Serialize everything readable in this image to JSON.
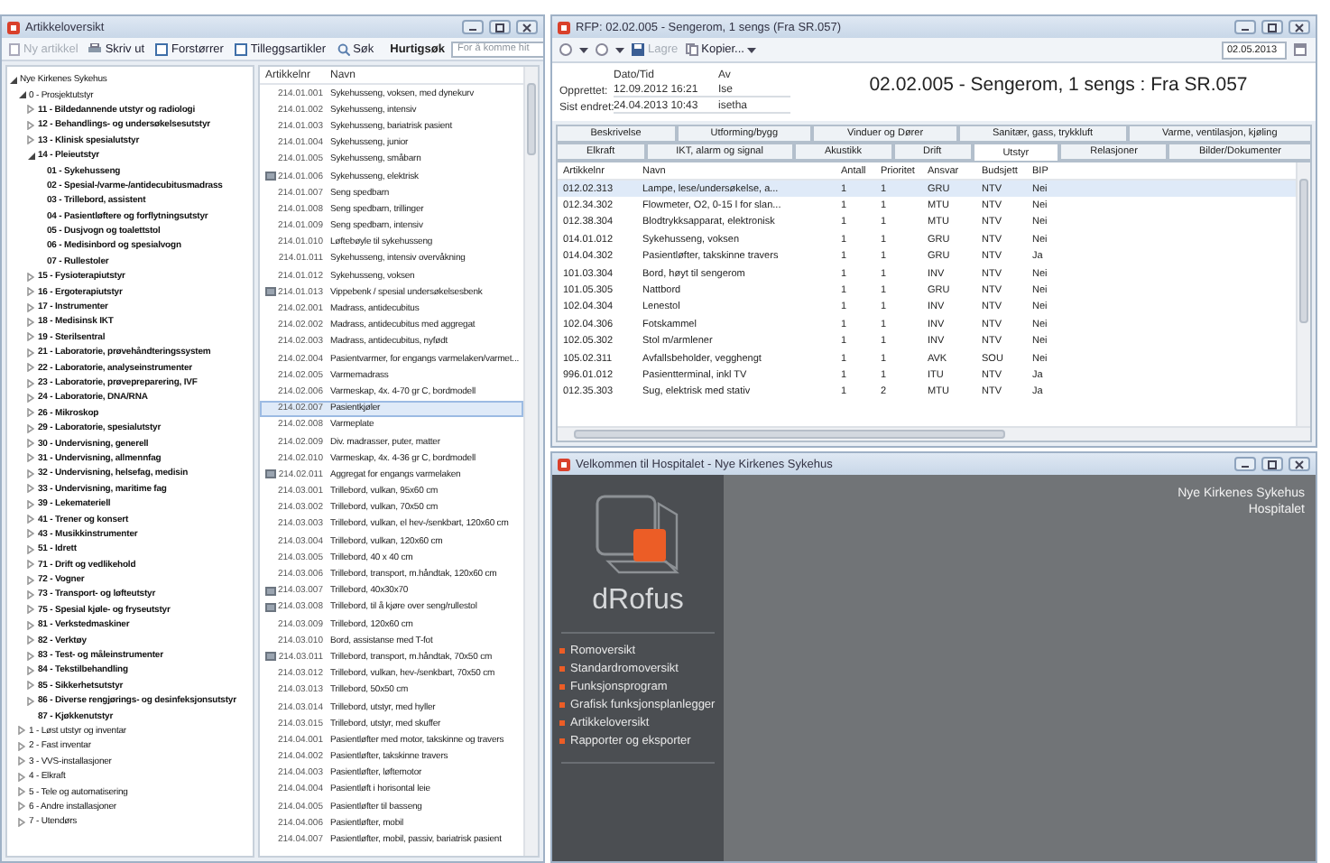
{
  "article_window": {
    "title": "Artikkeloversikt",
    "toolbar": [
      {
        "label": "Ny artikkel",
        "disabled": true
      },
      {
        "label": "Skriv ut",
        "disabled": false
      },
      {
        "label": "Forstørrer",
        "disabled": false
      },
      {
        "label": "Tilleggsartikler",
        "disabled": false
      },
      {
        "label": "Søk",
        "disabled": false
      }
    ],
    "quick_search": {
      "label": "Hurtigsøk",
      "placeholder": "For å komme hit"
    },
    "tree": [
      {
        "label": "Nye Kirkenes Sykehus",
        "expanded": true,
        "children": [
          {
            "label": "0 - Prosjektutstyr",
            "expanded": true,
            "children": [
              {
                "label": "11 - Bildedannende utstyr og radiologi",
                "expanded": false
              },
              {
                "label": "12 - Behandlings- og undersøkelsesutstyr",
                "expanded": false
              },
              {
                "label": "13 - Klinisk spesialutstyr",
                "expanded": false
              },
              {
                "label": "14 - Pleieutstyr",
                "expanded": true,
                "children": [
                  {
                    "label": "01 - Sykehusseng"
                  },
                  {
                    "label": "02 - Spesial-/varme-/antidecubitusmadrass"
                  },
                  {
                    "label": "03 - Trillebord, assistent"
                  },
                  {
                    "label": "04 - Pasientløftere og forflytningsutstyr"
                  },
                  {
                    "label": "05 - Dusjvogn og toalettstol"
                  },
                  {
                    "label": "06 - Medisinbord og spesialvogn"
                  },
                  {
                    "label": "07 - Rullestoler"
                  }
                ]
              },
              {
                "label": "15 - Fysioterapiutstyr",
                "expanded": false
              },
              {
                "label": "16 - Ergoterapiutstyr",
                "expanded": false
              },
              {
                "label": "17 - Instrumenter",
                "expanded": false
              },
              {
                "label": "18 - Medisinsk IKT",
                "expanded": false
              },
              {
                "label": "19 - Sterilsentral",
                "expanded": false
              },
              {
                "label": "21 - Laboratorie, prøvehåndteringssystem",
                "expanded": false
              },
              {
                "label": "22 - Laboratorie, analyseinstrumenter",
                "expanded": false
              },
              {
                "label": "23 - Laboratorie, prøvepreparering, IVF",
                "expanded": false
              },
              {
                "label": "24 - Laboratorie, DNA/RNA",
                "expanded": false
              },
              {
                "label": "26 - Mikroskop",
                "expanded": false
              },
              {
                "label": "29 - Laboratorie, spesialutstyr",
                "expanded": false
              },
              {
                "label": "30 - Undervisning, generell",
                "expanded": false
              },
              {
                "label": "31 - Undervisning, allmennfag",
                "expanded": false
              },
              {
                "label": "32 - Undervisning, helsefag, medisin",
                "expanded": false
              },
              {
                "label": "33 - Undervisning, maritime fag",
                "expanded": false
              },
              {
                "label": "39 - Lekemateriell",
                "expanded": false
              },
              {
                "label": "41 - Trener og konsert",
                "expanded": false
              },
              {
                "label": "43 - Musikkinstrumenter",
                "expanded": false
              },
              {
                "label": "51 - Idrett",
                "expanded": false
              },
              {
                "label": "71 - Drift og vedlikehold",
                "expanded": false
              },
              {
                "label": "72 - Vogner",
                "expanded": false
              },
              {
                "label": "73 - Transport- og løfteutstyr",
                "expanded": false
              },
              {
                "label": "75 - Spesial kjøle- og fryseutstyr",
                "expanded": false
              },
              {
                "label": "81 - Verkstedmaskiner",
                "expanded": false
              },
              {
                "label": "82 - Verktøy",
                "expanded": false
              },
              {
                "label": "83 - Test- og måleinstrumenter",
                "expanded": false
              },
              {
                "label": "84 - Tekstilbehandling",
                "expanded": false
              },
              {
                "label": "85 - Sikkerhetsutstyr",
                "expanded": false
              },
              {
                "label": "86 - Diverse rengjørings- og desinfeksjonsutstyr",
                "expanded": false
              },
              {
                "label": "87 - Kjøkkenutstyr"
              }
            ]
          },
          {
            "label": "1 - Løst utstyr og inventar",
            "expanded": false
          },
          {
            "label": "2 - Fast inventar",
            "expanded": false
          },
          {
            "label": "3 - VVS-installasjoner",
            "expanded": false
          },
          {
            "label": "4 - Elkraft",
            "expanded": false
          },
          {
            "label": "5 - Tele og automatisering",
            "expanded": false
          },
          {
            "label": "6 - Andre installasjoner",
            "expanded": false
          },
          {
            "label": "7 - Utendørs",
            "expanded": false
          }
        ]
      }
    ],
    "list": {
      "columns": [
        "Artikkelnr",
        "Navn"
      ],
      "rows": [
        {
          "code": "214.01.001",
          "name": "Sykehusseng, voksen, med dynekurv",
          "marked": false,
          "selected": false
        },
        {
          "code": "214.01.002",
          "name": "Sykehusseng, intensiv",
          "marked": false,
          "selected": false
        },
        {
          "code": "214.01.003",
          "name": "Sykehusseng, bariatrisk pasient",
          "marked": false,
          "selected": false
        },
        {
          "code": "214.01.004",
          "name": "Sykehusseng, junior",
          "marked": false,
          "selected": false
        },
        {
          "code": "214.01.005",
          "name": "Sykehusseng, småbarn",
          "marked": false,
          "selected": false
        },
        {
          "code": "214.01.006",
          "name": "Sykehusseng, elektrisk",
          "marked": true,
          "selected": false
        },
        {
          "code": "214.01.007",
          "name": "Seng spedbarn",
          "marked": false,
          "selected": false
        },
        {
          "code": "214.01.008",
          "name": "Seng spedbarn, trillinger",
          "marked": false,
          "selected": false
        },
        {
          "code": "214.01.009",
          "name": "Seng spedbarn, intensiv",
          "marked": false,
          "selected": false
        },
        {
          "code": "214.01.010",
          "name": "Løftebøyle til sykehusseng",
          "marked": false,
          "selected": false
        },
        {
          "code": "214.01.011",
          "name": "Sykehusseng, intensiv overvåkning",
          "marked": false,
          "selected": false
        },
        {
          "code": "214.01.012",
          "name": "Sykehusseng, voksen",
          "marked": false,
          "selected": false
        },
        {
          "code": "214.01.013",
          "name": "Vippebenk / spesial undersøkelsesbenk",
          "marked": true,
          "selected": false
        },
        {
          "code": "214.02.001",
          "name": "Madrass, antidecubitus",
          "marked": false,
          "selected": false
        },
        {
          "code": "214.02.002",
          "name": "Madrass, antidecubitus med aggregat",
          "marked": false,
          "selected": false
        },
        {
          "code": "214.02.003",
          "name": "Madrass, antidecubitus, nyfødt",
          "marked": false,
          "selected": false
        },
        {
          "code": "214.02.004",
          "name": "Pasientvarmer, for engangs varmelaken/varmet...",
          "marked": false,
          "selected": false
        },
        {
          "code": "214.02.005",
          "name": "Varmemadrass",
          "marked": false,
          "selected": false
        },
        {
          "code": "214.02.006",
          "name": "Varmeskap, 4x. 4-70 gr C, bordmodell",
          "marked": false,
          "selected": false
        },
        {
          "code": "214.02.007",
          "name": "Pasientkjøler",
          "marked": false,
          "selected": true
        },
        {
          "code": "214.02.008",
          "name": "Varmeplate",
          "marked": false,
          "selected": false
        },
        {
          "code": "214.02.009",
          "name": "Div. madrasser, puter, matter",
          "marked": false,
          "selected": false
        },
        {
          "code": "214.02.010",
          "name": "Varmeskap, 4x. 4-36 gr C, bordmodell",
          "marked": false,
          "selected": false
        },
        {
          "code": "214.02.011",
          "name": "Aggregat for engangs varmelaken",
          "marked": true,
          "selected": false
        },
        {
          "code": "214.03.001",
          "name": "Trillebord, vulkan, 95x60 cm",
          "marked": false,
          "selected": false
        },
        {
          "code": "214.03.002",
          "name": "Trillebord, vulkan, 70x50 cm",
          "marked": false,
          "selected": false
        },
        {
          "code": "214.03.003",
          "name": "Trillebord, vulkan, el hev-/senkbart, 120x60 cm",
          "marked": false,
          "selected": false
        },
        {
          "code": "214.03.004",
          "name": "Trillebord, vulkan, 120x60 cm",
          "marked": false,
          "selected": false
        },
        {
          "code": "214.03.005",
          "name": "Trillebord, 40 x 40 cm",
          "marked": false,
          "selected": false
        },
        {
          "code": "214.03.006",
          "name": "Trillebord, transport, m.håndtak, 120x60 cm",
          "marked": false,
          "selected": false
        },
        {
          "code": "214.03.007",
          "name": "Trillebord, 40x30x70",
          "marked": true,
          "selected": false
        },
        {
          "code": "214.03.008",
          "name": "Trillebord, til å kjøre over seng/rullestol",
          "marked": true,
          "selected": false
        },
        {
          "code": "214.03.009",
          "name": "Trillebord, 120x60 cm",
          "marked": false,
          "selected": false
        },
        {
          "code": "214.03.010",
          "name": "Bord, assistanse med T-fot",
          "marked": false,
          "selected": false
        },
        {
          "code": "214.03.011",
          "name": "Trillebord, transport, m.håndtak, 70x50 cm",
          "marked": true,
          "selected": false
        },
        {
          "code": "214.03.012",
          "name": "Trillebord, vulkan, hev-/senkbart, 70x50 cm",
          "marked": false,
          "selected": false
        },
        {
          "code": "214.03.013",
          "name": "Trillebord, 50x50 cm",
          "marked": false,
          "selected": false
        },
        {
          "code": "214.03.014",
          "name": "Trillebord, utstyr, med hyller",
          "marked": false,
          "selected": false
        },
        {
          "code": "214.03.015",
          "name": "Trillebord, utstyr, med skuffer",
          "marked": false,
          "selected": false
        },
        {
          "code": "214.04.001",
          "name": "Pasientløfter med motor, takskinne og travers",
          "marked": false,
          "selected": false
        },
        {
          "code": "214.04.002",
          "name": "Pasientløfter, takskinne travers",
          "marked": false,
          "selected": false
        },
        {
          "code": "214.04.003",
          "name": "Pasientløfter, løftemotor",
          "marked": false,
          "selected": false
        },
        {
          "code": "214.04.004",
          "name": "Pasientløft i horisontal leie",
          "marked": false,
          "selected": false
        },
        {
          "code": "214.04.005",
          "name": "Pasientløfter til basseng",
          "marked": false,
          "selected": false
        },
        {
          "code": "214.04.006",
          "name": "Pasientløfter, mobil",
          "marked": false,
          "selected": false
        },
        {
          "code": "214.04.007",
          "name": "Pasientløfter, mobil, passiv, bariatrisk pasient",
          "marked": false,
          "selected": false
        }
      ]
    }
  },
  "room_window": {
    "title": "RFP: 02.02.005 - Sengerom, 1 sengs (Fra SR.057)",
    "toolbar": {
      "save": {
        "label": "Lagre",
        "disabled": true
      },
      "copy": {
        "label": "Kopier..."
      },
      "date": "02.05.2013"
    },
    "info": {
      "headers": [
        "Dato/Tid",
        "Av"
      ],
      "rows": [
        {
          "label": "Opprettet:",
          "date": "12.09.2012 16:21",
          "by": "Ise"
        },
        {
          "label": "Sist endret:",
          "date": "24.04.2013 10:43",
          "by": "isetha"
        }
      ]
    },
    "heading": "02.02.005 - Sengerom, 1 sengs : Fra SR.057",
    "tabs": [
      [
        {
          "label": "Beskrivelse",
          "selected": false
        },
        {
          "label": "Utforming/bygg",
          "selected": false
        },
        {
          "label": "Vinduer og Dører",
          "selected": false
        },
        {
          "label": "Sanitær, gass, trykkluft",
          "selected": false
        },
        {
          "label": "Varme, ventilasjon, kjøling",
          "selected": false
        }
      ],
      [
        {
          "label": "Elkraft",
          "selected": false
        },
        {
          "label": "IKT, alarm og signal",
          "selected": false
        },
        {
          "label": "Akustikk",
          "selected": false
        },
        {
          "label": "Drift",
          "selected": false
        },
        {
          "label": "Utstyr",
          "selected": true
        },
        {
          "label": "Relasjoner",
          "selected": false
        },
        {
          "label": "Bilder/Dokumenter",
          "selected": false
        }
      ]
    ],
    "table": {
      "columns": [
        "Artikkelnr",
        "Navn",
        "Antall",
        "Prioritet",
        "Ansvar",
        "Budsjett",
        "BIP"
      ],
      "rows": [
        {
          "cells": [
            "012.02.313",
            "Lampe, lese/undersøkelse, a...",
            "1",
            "1",
            "GRU",
            "NTV",
            "Nei"
          ],
          "selected": true
        },
        {
          "cells": [
            "012.34.302",
            "Flowmeter, O2, 0-15 l for slan...",
            "1",
            "1",
            "MTU",
            "NTV",
            "Nei"
          ],
          "selected": false
        },
        {
          "cells": [
            "012.38.304",
            "Blodtrykksapparat, elektronisk",
            "1",
            "1",
            "MTU",
            "NTV",
            "Nei"
          ],
          "selected": false
        },
        {
          "cells": [
            "014.01.012",
            "Sykehusseng, voksen",
            "1",
            "1",
            "GRU",
            "NTV",
            "Nei"
          ],
          "selected": false
        },
        {
          "cells": [
            "014.04.302",
            "Pasientløfter, takskinne travers",
            "1",
            "1",
            "GRU",
            "NTV",
            "Ja"
          ],
          "selected": false
        },
        {
          "cells": [
            "101.03.304",
            "Bord, høyt til sengerom",
            "1",
            "1",
            "INV",
            "NTV",
            "Nei"
          ],
          "selected": false
        },
        {
          "cells": [
            "101.05.305",
            "Nattbord",
            "1",
            "1",
            "GRU",
            "NTV",
            "Nei"
          ],
          "selected": false
        },
        {
          "cells": [
            "102.04.304",
            "Lenestol",
            "1",
            "1",
            "INV",
            "NTV",
            "Nei"
          ],
          "selected": false
        },
        {
          "cells": [
            "102.04.306",
            "Fotskammel",
            "1",
            "1",
            "INV",
            "NTV",
            "Nei"
          ],
          "selected": false
        },
        {
          "cells": [
            "102.05.302",
            "Stol m/armlener",
            "1",
            "1",
            "INV",
            "NTV",
            "Nei"
          ],
          "selected": false
        },
        {
          "cells": [
            "105.02.311",
            "Avfallsbeholder, vegghengt",
            "1",
            "1",
            "AVK",
            "SOU",
            "Nei"
          ],
          "selected": false
        },
        {
          "cells": [
            "996.01.012",
            "Pasientterminal, inkl TV",
            "1",
            "1",
            "ITU",
            "NTV",
            "Ja"
          ],
          "selected": false
        },
        {
          "cells": [
            "012.35.303",
            "Sug, elektrisk med stativ",
            "1",
            "2",
            "MTU",
            "NTV",
            "Ja"
          ],
          "selected": false
        }
      ]
    }
  },
  "welcome_window": {
    "title": "Velkommen til Hospitalet - Nye Kirkenes Sykehus",
    "logo_text": "dRofus",
    "menu": [
      "Romoversikt",
      "Standardromoversikt",
      "Funksjonsprogram",
      "Grafisk funksjonsplanlegger",
      "Artikkeloversikt",
      "Rapporter og eksporter"
    ],
    "project": [
      "Nye Kirkenes Sykehus",
      "Hospitalet"
    ]
  }
}
